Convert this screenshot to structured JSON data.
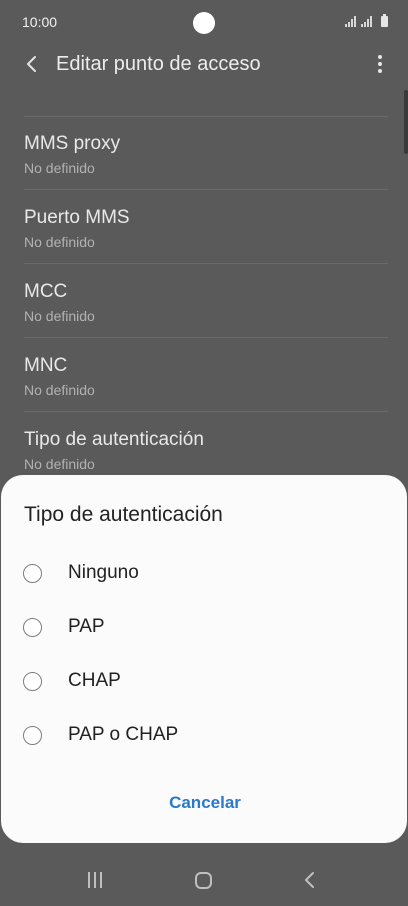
{
  "status": {
    "time": "10:00"
  },
  "appbar": {
    "title": "Editar punto de acceso",
    "back_icon": "chevron-left-icon",
    "more_icon": "more-vert-icon"
  },
  "settings": [
    {
      "name": "MMS proxy",
      "value": "No definido"
    },
    {
      "name": "Puerto MMS",
      "value": "No definido"
    },
    {
      "name": "MCC",
      "value": "No definido"
    },
    {
      "name": "MNC",
      "value": "No definido"
    },
    {
      "name": "Tipo de autenticación",
      "value": "No definido"
    }
  ],
  "dialog": {
    "title": "Tipo de autenticación",
    "options": [
      "Ninguno",
      "PAP",
      "CHAP",
      "PAP o CHAP"
    ],
    "cancel_label": "Cancelar"
  },
  "colors": {
    "accent": "#2a78cc",
    "scrim": "#5a5a5a",
    "dialog_bg": "#fbfbfb"
  }
}
